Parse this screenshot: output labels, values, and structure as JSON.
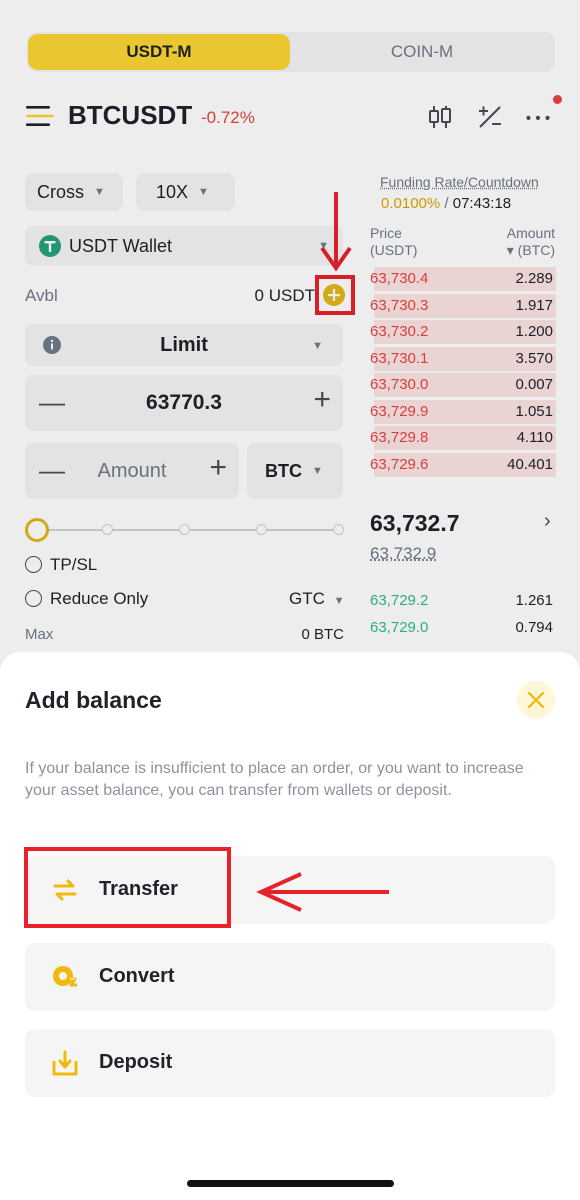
{
  "tabs": [
    {
      "label": "USDT-M",
      "active": true
    },
    {
      "label": "COIN-M",
      "active": false
    }
  ],
  "header": {
    "pair": "BTCUSDT",
    "change": "-0.72%"
  },
  "order_form": {
    "margin_mode": "Cross",
    "leverage": "10X",
    "wallet": "USDT Wallet",
    "avbl_label": "Avbl",
    "avbl_value": "0 USDT",
    "order_type": "Limit",
    "price": "63770.3",
    "amount_placeholder": "Amount",
    "amount_unit": "BTC",
    "tpsl_label": "TP/SL",
    "reduce_only_label": "Reduce Only",
    "tif": "GTC",
    "max_label": "Max",
    "max_value": "0 BTC"
  },
  "orderbook": {
    "funding_label": "Funding Rate/Countdown",
    "funding_rate": "0.0100%",
    "separator": "/",
    "countdown": "07:43:18",
    "price_header": "Price",
    "price_unit": "(USDT)",
    "amount_header": "Amount",
    "amount_unit": "▾ (BTC)",
    "asks": [
      {
        "price": "63,730.4",
        "amount": "2.289",
        "depth": 0.96
      },
      {
        "price": "63,730.3",
        "amount": "1.917",
        "depth": 0.96
      },
      {
        "price": "63,730.2",
        "amount": "1.200",
        "depth": 0.96
      },
      {
        "price": "63,730.1",
        "amount": "3.570",
        "depth": 0.96
      },
      {
        "price": "63,730.0",
        "amount": "0.007",
        "depth": 0.96
      },
      {
        "price": "63,729.9",
        "amount": "1.051",
        "depth": 0.96
      },
      {
        "price": "63,729.8",
        "amount": "4.110",
        "depth": 0.96
      },
      {
        "price": "63,729.6",
        "amount": "40.401",
        "depth": 0.96
      }
    ],
    "last_price": "63,732.7",
    "mark_price": "63,732.9",
    "bids": [
      {
        "price": "63,729.2",
        "amount": "1.261"
      },
      {
        "price": "63,729.0",
        "amount": "0.794"
      }
    ]
  },
  "sheet": {
    "title": "Add balance",
    "description": "If your balance is insufficient to place an order, or you want to increase your asset balance, you can transfer from wallets or deposit.",
    "options": [
      {
        "label": "Transfer",
        "icon": "transfer-icon"
      },
      {
        "label": "Convert",
        "icon": "convert-icon"
      },
      {
        "label": "Deposit",
        "icon": "deposit-icon"
      }
    ]
  },
  "colors": {
    "brand": "#fcd535",
    "sell": "#e9443f",
    "buy": "#2ebd85",
    "annotation": "#e8222a"
  }
}
